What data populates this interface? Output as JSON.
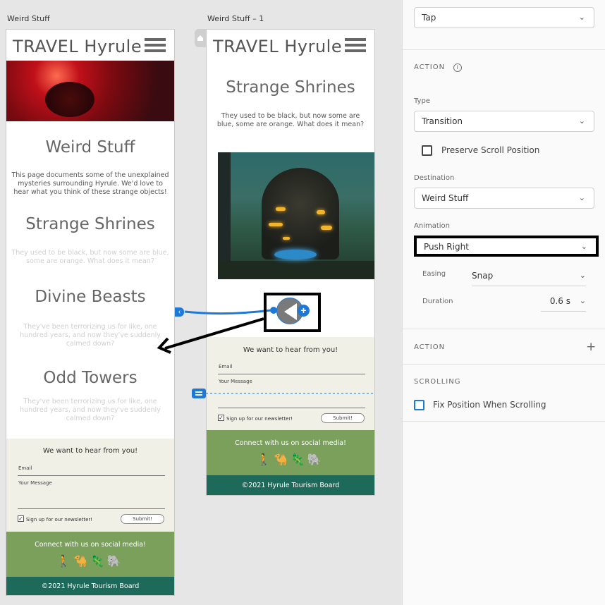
{
  "artboards": {
    "left": {
      "label": "Weird Stuff",
      "brand": "TRAVEL Hyrule",
      "sections": [
        {
          "heading": "Weird Stuff",
          "text": "This page documents some of the unexplained mysteries surrounding Hyrule. We'd love to hear what you think of these strange objects!"
        },
        {
          "heading": "Strange Shrines",
          "text": "They used to be black, but now some are blue, some are orange. What does it mean?"
        },
        {
          "heading": "Divine Beasts",
          "text": "They've been terrorizing us for like, one hundred years, and now they've suddenly calmed down?"
        },
        {
          "heading": "Odd Towers",
          "text": "They've been terrorizing us for like, one hundred years, and now they've suddenly calmed down?"
        }
      ],
      "contact": {
        "title": "We want to hear from you!",
        "email_label": "Email",
        "message_label": "Your Message",
        "newsletter_label": "Sign up for our newsletter!",
        "submit_label": "Submit!"
      },
      "social": {
        "title": "Connect with us on social media!",
        "icons": "🚶🐪🦎🐘"
      },
      "footer": "©2021 Hyrule Tourism Board"
    },
    "right": {
      "label": "Weird Stuff – 1",
      "brand": "TRAVEL Hyrule",
      "heading": "Strange Shrines",
      "text": "They used to be black, but now some are blue, some are orange. What does it mean?",
      "contact": {
        "title": "We want to hear from you!",
        "email_label": "Email",
        "message_label": "Your Message",
        "newsletter_label": "Sign up for our newsletter!",
        "submit_label": "Submit!"
      },
      "social": {
        "title": "Connect with us on social media!",
        "icons": "🚶🐪🦎🐘"
      },
      "footer": "©2021 Hyrule Tourism Board"
    }
  },
  "panel": {
    "trigger_value": "Tap",
    "action_title": "ACTION",
    "type_label": "Type",
    "type_value": "Transition",
    "preserve_scroll_label": "Preserve Scroll Position",
    "destination_label": "Destination",
    "destination_value": "Weird Stuff",
    "animation_label": "Animation",
    "animation_value": "Push Right",
    "easing_label": "Easing",
    "easing_value": "Snap",
    "duration_label": "Duration",
    "duration_value": "0.6 s",
    "action2_title": "ACTION",
    "add_symbol": "+",
    "scrolling_title": "SCROLLING",
    "fix_position_label": "Fix Position When Scrolling"
  },
  "colors": {
    "social_bg": "#7aa05c",
    "footer_bg": "#1e6a5a",
    "contact_bg": "#f0f0e6",
    "connector_blue": "#1e78d6"
  }
}
